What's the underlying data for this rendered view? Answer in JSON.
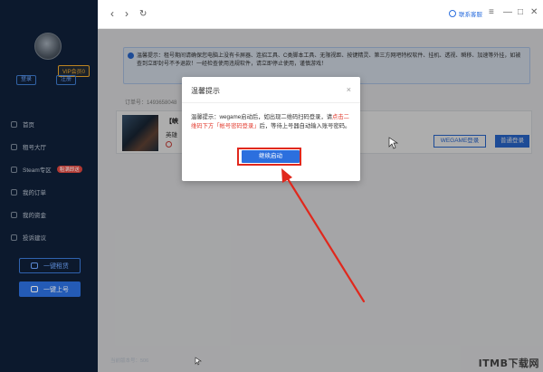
{
  "sidebar": {
    "vip_badge": "VIP会员0",
    "login_label": "登录",
    "register_label": "注册",
    "nav": [
      {
        "label": "首页",
        "icon": "home-icon"
      },
      {
        "label": "租号大厅",
        "icon": "hall-icon"
      },
      {
        "label": "Steam专区",
        "icon": "steam-icon",
        "badge": "租满即送"
      },
      {
        "label": "我的订单",
        "icon": "order-icon"
      },
      {
        "label": "我的资金",
        "icon": "wallet-icon"
      },
      {
        "label": "投诉建议",
        "icon": "feedback-icon"
      }
    ],
    "quick_rent_label": "一键租赁",
    "quick_login_label": "一键上号",
    "version": "当前版本号：506"
  },
  "topbar": {
    "back_icon": "‹",
    "forward_icon": "›",
    "refresh_icon": "↻",
    "contact_label": "联系客服",
    "menu_icon": "≡",
    "min_icon": "—",
    "max_icon": "□",
    "close_icon": "✕"
  },
  "main": {
    "notice": "温馨提示：租号期间请确保您电脑上没有卡屏器、连招工具、C类脚本工具、无限视距、按键精灵、第三方网吧特权软件、挂机、透视、瞬移、加速等外挂，如被查到立即封号不予退款！一经检查使用违规软件，请立即停止使用，谨慎游戏！",
    "order_no": "订单号：1493658048",
    "card_title": "【峡",
    "card_sub": "英雄",
    "wegame_btn": "WEGAME登录",
    "normal_btn": "普通登录"
  },
  "modal": {
    "title": "温馨提示",
    "close": "×",
    "body_1": "温馨提示：wegame启动后，如出现二维码扫码登录，请",
    "body_red": "点击二维码下方「帐号密码登录」",
    "body_2": "后，等待上号器自动输入账号密码。",
    "continue_btn": "继续启动"
  },
  "watermark": "ITMB下载网",
  "colors": {
    "sidebar_bg": "#0f1f37",
    "accent": "#2c6fde",
    "annotation_red": "#e0281d"
  }
}
